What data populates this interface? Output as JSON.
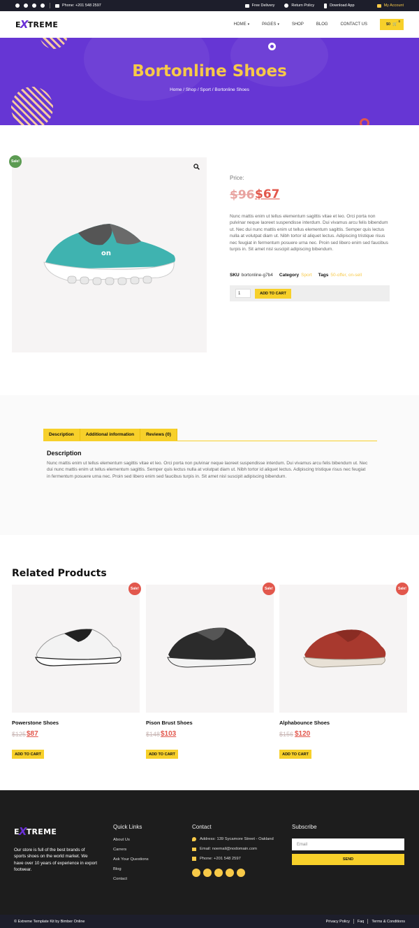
{
  "topbar": {
    "phone": "Phone: +201 548 2597",
    "free_delivery": "Free Delivery",
    "return_policy": "Return Policy",
    "download_app": "Download App",
    "my_account": "My Account"
  },
  "header": {
    "logo_pre": "E",
    "logo_x": "X",
    "logo_post": "TREME",
    "nav": [
      "HOME",
      "PAGES",
      "SHOP",
      "BLOG",
      "CONTACT US"
    ],
    "cart_total": "$0",
    "cart_count": "0"
  },
  "hero": {
    "title": "Bortonline Shoes",
    "breadcrumb": "Home / Shop / Sport / Bortonline Shoes"
  },
  "product": {
    "sale_badge": "Sale!",
    "price_label": "Price:",
    "old_price": "$96",
    "new_price": "$67",
    "short_description": "Nunc mattis enim ut tellus elementum sagittis vitae et leo. Orci porta non pulvinar neque laoreet suspendisse interdum. Dui vivamus arcu felis bibendum ut. Nec dui nunc mattis enim ut tellus elementum sagittis. Semper quis lectus nulla at volutpat diam ut. Nibh tortor id aliquet lectus. Adipiscing tristique risus nec feugiat in fermentum posuere urna nec. Proin sed libero enim sed faucibus turpis in. Sit amet nisl suscipit adipiscing bibendum.",
    "sku_label": "SKU",
    "sku": "bortonline-g7b4",
    "category_label": "Category",
    "category": "Sport",
    "tags_label": "Tags",
    "tags": "50-offer, on-sell",
    "quantity": "1",
    "add_to_cart": "ADD TO CART"
  },
  "tabs": {
    "items": [
      "Description",
      "Additional information",
      "Reviews (0)"
    ],
    "description_title": "Description",
    "description_body": "Nunc mattis enim ut tellus elementum sagittis vitae et leo. Orci porta non pulvinar neque laoreet suspendisse interdum. Dui vivamus arcu felis bibendum ut. Nec dui nunc mattis enim ut tellus elementum sagittis. Semper quis lectus nulla at volutpat diam ut. Nibh tortor id aliquet lectus. Adipiscing tristique risus nec feugiat in fermentum posuere urna nec. Proin sed libero enim sed faucibus turpis in. Sit amet nisl suscipit adipiscing bibendum."
  },
  "related": {
    "title": "Related Products",
    "items": [
      {
        "name": "Powerstone Shoes",
        "old_price": "$125",
        "new_price": "$87",
        "badge": "Sale!",
        "button": "ADD TO CART",
        "color": "#f0f0f0"
      },
      {
        "name": "Pison Brust Shoes",
        "old_price": "$148",
        "new_price": "$103",
        "badge": "Sale!",
        "button": "ADD TO CART",
        "color": "#2a2a2a"
      },
      {
        "name": "Alphabounce Shoes",
        "old_price": "$156",
        "new_price": "$120",
        "badge": "Sale!",
        "button": "ADD TO CART",
        "color": "#a8392e"
      }
    ]
  },
  "footer": {
    "about": "Our store is full of the best brands of sports shoes on the world market. We have over 10 years of experience in export footwear.",
    "quick_links_title": "Quick Links",
    "quick_links": [
      "About Us",
      "Carrers",
      "Ask Your Questions",
      "Blog",
      "Contact"
    ],
    "contact_title": "Contact",
    "address": "Address: 139 Sycamore Street - Oakland",
    "email": "Email: noemail@nodomain.com",
    "phone": "Phone: +201 548 2597",
    "subscribe_title": "Subscribe",
    "email_placeholder": "Email",
    "send": "SEND",
    "copyright": "© Extreme Template Kit by Bimber Online",
    "bottom_links": [
      "Privacy Policy",
      "Faq",
      "Terms & Conditions"
    ]
  },
  "colors": {
    "accent_yellow": "#f7d02a",
    "hero_purple": "#6636d4",
    "sale_red": "#e2574c",
    "sale_green": "#5c9b52",
    "dark": "#1d1e2b"
  }
}
